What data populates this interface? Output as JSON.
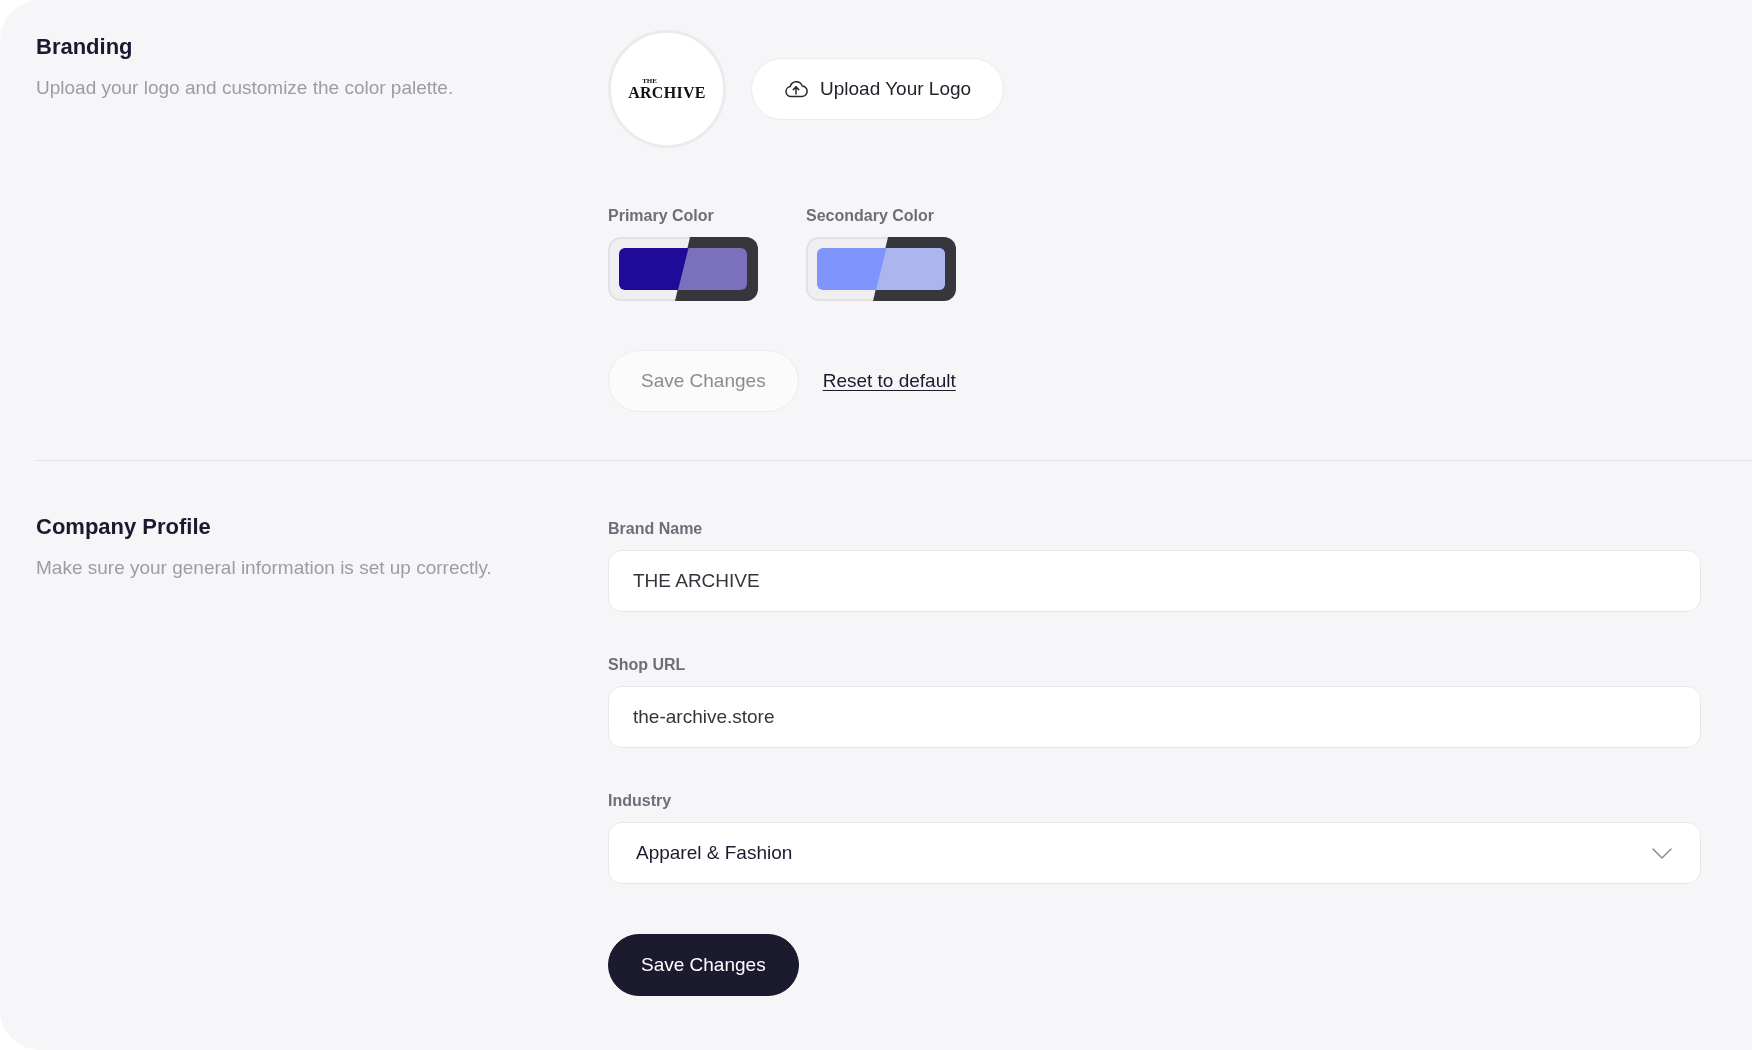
{
  "sections": [
    {
      "kind": "branding",
      "title": "Branding",
      "description": "Upload your logo and customize the color palette.",
      "logo": {
        "small_text": "THE",
        "wordmark": "ARCHIVE"
      },
      "upload_button": "Upload Your Logo",
      "colors": [
        {
          "label": "Primary Color",
          "color": "#1f0a99"
        },
        {
          "label": "Secondary Color",
          "color": "#7f95fd"
        }
      ],
      "actions": [
        {
          "kind": "button",
          "label": "Save Changes",
          "disabled": true
        },
        {
          "kind": "link",
          "label": "Reset to default"
        }
      ]
    },
    {
      "kind": "profile",
      "title": "Company Profile",
      "description": "Make sure your general information is set up correctly.",
      "fields": [
        {
          "kind": "text",
          "label": "Brand Name",
          "value": "THE ARCHIVE"
        },
        {
          "kind": "text",
          "label": "Shop URL",
          "value": "the-archive.store"
        },
        {
          "kind": "select",
          "label": "Industry",
          "value": "Apparel & Fashion"
        }
      ],
      "actions": [
        {
          "kind": "button",
          "label": "Save Changes",
          "disabled": false
        }
      ]
    }
  ]
}
